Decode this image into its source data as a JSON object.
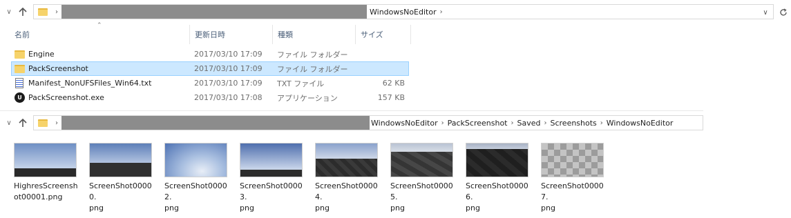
{
  "top_bar": {
    "back_icon": "chevron-down-icon",
    "up_icon": "up-arrow-icon",
    "path_last": "WindowsNoEditor",
    "dropdown_icon": "chevron-down-icon",
    "refresh_icon": "refresh-icon"
  },
  "columns": {
    "name": "名前",
    "modified": "更新日時",
    "type": "種類",
    "size": "サイズ"
  },
  "files": [
    {
      "name": "Engine",
      "modified": "2017/03/10 17:09",
      "type": "ファイル フォルダー",
      "size": "",
      "icon": "folder-icon"
    },
    {
      "name": "PackScreenshot",
      "modified": "2017/03/10 17:09",
      "type": "ファイル フォルダー",
      "size": "",
      "icon": "folder-icon",
      "selected": true
    },
    {
      "name": "Manifest_NonUFSFiles_Win64.txt",
      "modified": "2017/03/10 17:09",
      "type": "TXT ファイル",
      "size": "62 KB",
      "icon": "text-file-icon"
    },
    {
      "name": "PackScreenshot.exe",
      "modified": "2017/03/10 17:08",
      "type": "アプリケーション",
      "size": "157 KB",
      "icon": "unreal-app-icon"
    }
  ],
  "bottom_bar": {
    "crumbs": [
      "WindowsNoEditor",
      "PackScreenshot",
      "Saved",
      "Screenshots",
      "WindowsNoEditor"
    ]
  },
  "thumbnails": [
    {
      "line1": "HighresScreensh",
      "line2": "ot00001.png",
      "style": "sky"
    },
    {
      "line1": "ScreenShot00000.",
      "line2": "png",
      "style": "sky-dark"
    },
    {
      "line1": "ScreenShot00002.",
      "line2": "png",
      "style": "clouds"
    },
    {
      "line1": "ScreenShot00003.",
      "line2": "png",
      "style": "sky"
    },
    {
      "line1": "ScreenShot00004.",
      "line2": "png",
      "style": "floor"
    },
    {
      "line1": "ScreenShot00005.",
      "line2": "png",
      "style": "floor"
    },
    {
      "line1": "ScreenShot00006.",
      "line2": "png",
      "style": "floor-dark"
    },
    {
      "line1": "ScreenShot00007.",
      "line2": "png",
      "style": "checker"
    }
  ]
}
